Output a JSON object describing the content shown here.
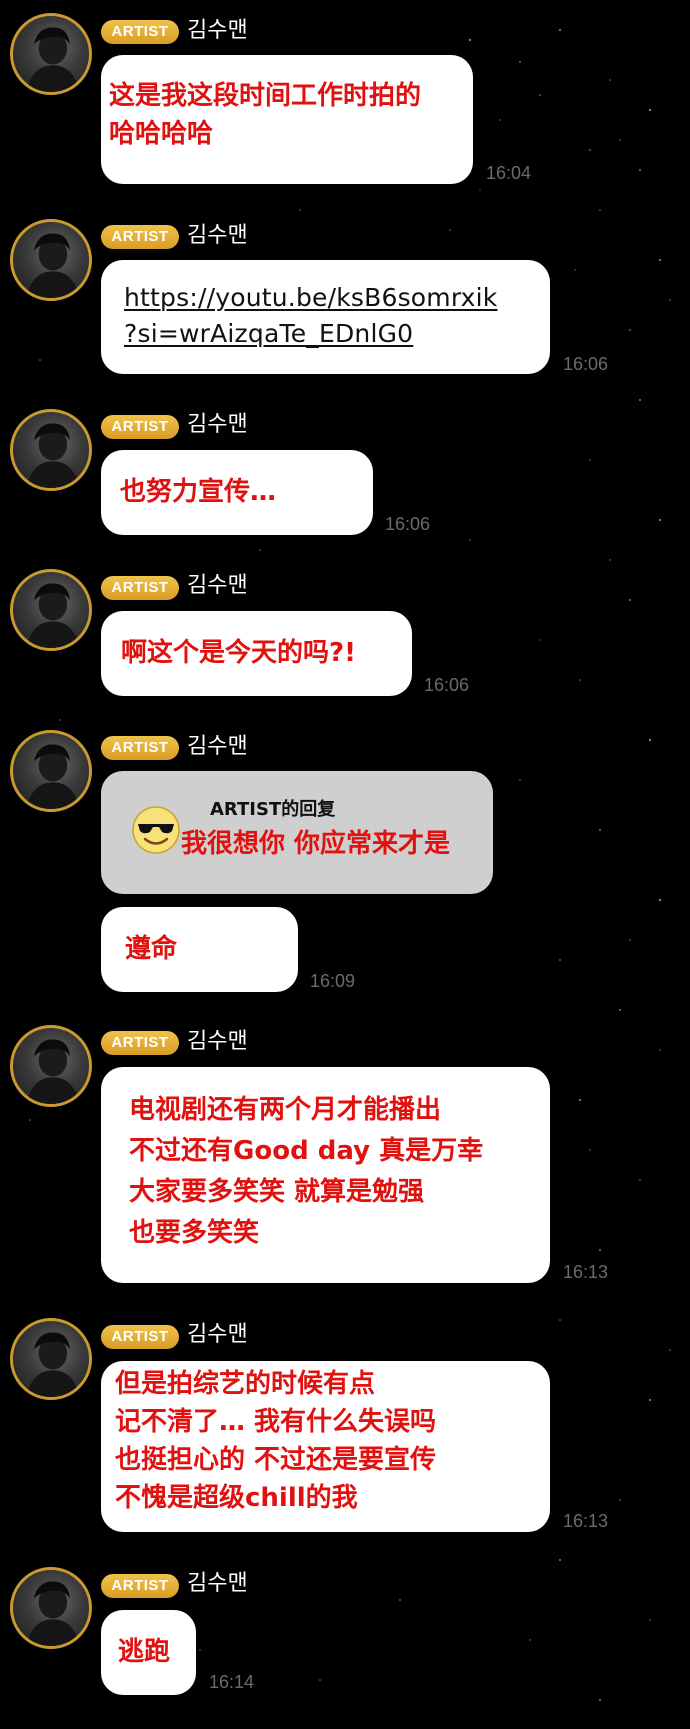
{
  "theme": {
    "background": "#000000",
    "bubble_bg": "#ffffff",
    "reply_bg": "#cfcfcf",
    "text_red": "#e0110f",
    "badge_gold": "#e3aa32",
    "timestamp_gray": "#6a6a6a"
  },
  "messages": [
    {
      "badge": "ARTIST",
      "sender": "김수맨",
      "text": "这是我这段时间工作时拍的\n哈哈哈哈",
      "time": "16:04"
    },
    {
      "badge": "ARTIST",
      "sender": "김수맨",
      "link": "https://youtu.be/ksB6somrxik\n?si=wrAizqaTe_EDnlG0",
      "time": "16:06"
    },
    {
      "badge": "ARTIST",
      "sender": "김수맨",
      "text": "也努力宣传…",
      "time": "16:06"
    },
    {
      "badge": "ARTIST",
      "sender": "김수맨",
      "text": "啊这个是今天的吗?!",
      "time": "16:06"
    },
    {
      "badge": "ARTIST",
      "sender": "김수맨",
      "reply_label": "ARTIST的回复",
      "reply_text": "我很想你 你应常来才是",
      "reply_icon": "sunglasses-emoji-icon",
      "text": "遵命",
      "time": "16:09"
    },
    {
      "badge": "ARTIST",
      "sender": "김수맨",
      "text": "电视剧还有两个月才能播出\n不过还有Good day 真是万幸\n大家要多笑笑 就算是勉强\n也要多笑笑",
      "time": "16:13"
    },
    {
      "badge": "ARTIST",
      "sender": "김수맨",
      "text": "但是拍综艺的时候有点\n记不清了… 我有什么失误吗\n也挺担心的 不过还是要宣传\n不愧是超级chill的我",
      "time": "16:13"
    },
    {
      "badge": "ARTIST",
      "sender": "김수맨",
      "text": "逃跑",
      "time": "16:14"
    }
  ]
}
